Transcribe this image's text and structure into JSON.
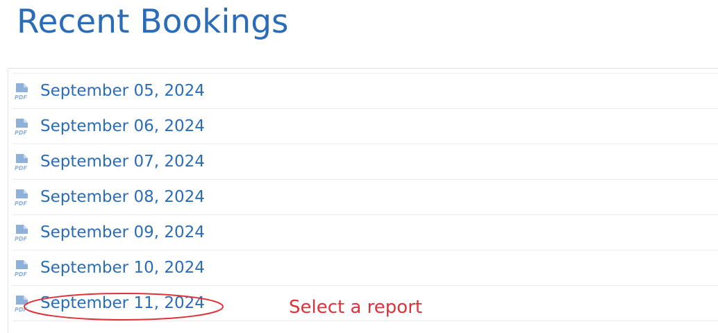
{
  "page": {
    "title": "Recent Bookings"
  },
  "reports": [
    {
      "label": "September 05, 2024",
      "icon": "pdf-icon"
    },
    {
      "label": "September 06, 2024",
      "icon": "pdf-icon"
    },
    {
      "label": "September 07, 2024",
      "icon": "pdf-icon"
    },
    {
      "label": "September 08, 2024",
      "icon": "pdf-icon"
    },
    {
      "label": "September 09, 2024",
      "icon": "pdf-icon"
    },
    {
      "label": "September 10, 2024",
      "icon": "pdf-icon"
    },
    {
      "label": "September 11, 2024",
      "icon": "pdf-icon"
    }
  ],
  "annotation": {
    "text": "Select a report",
    "target": "September 11, 2024",
    "color": "#e0313a"
  },
  "colors": {
    "link": "#2a6cb8",
    "icon": "#8fb0d8",
    "divider": "#ececec"
  }
}
